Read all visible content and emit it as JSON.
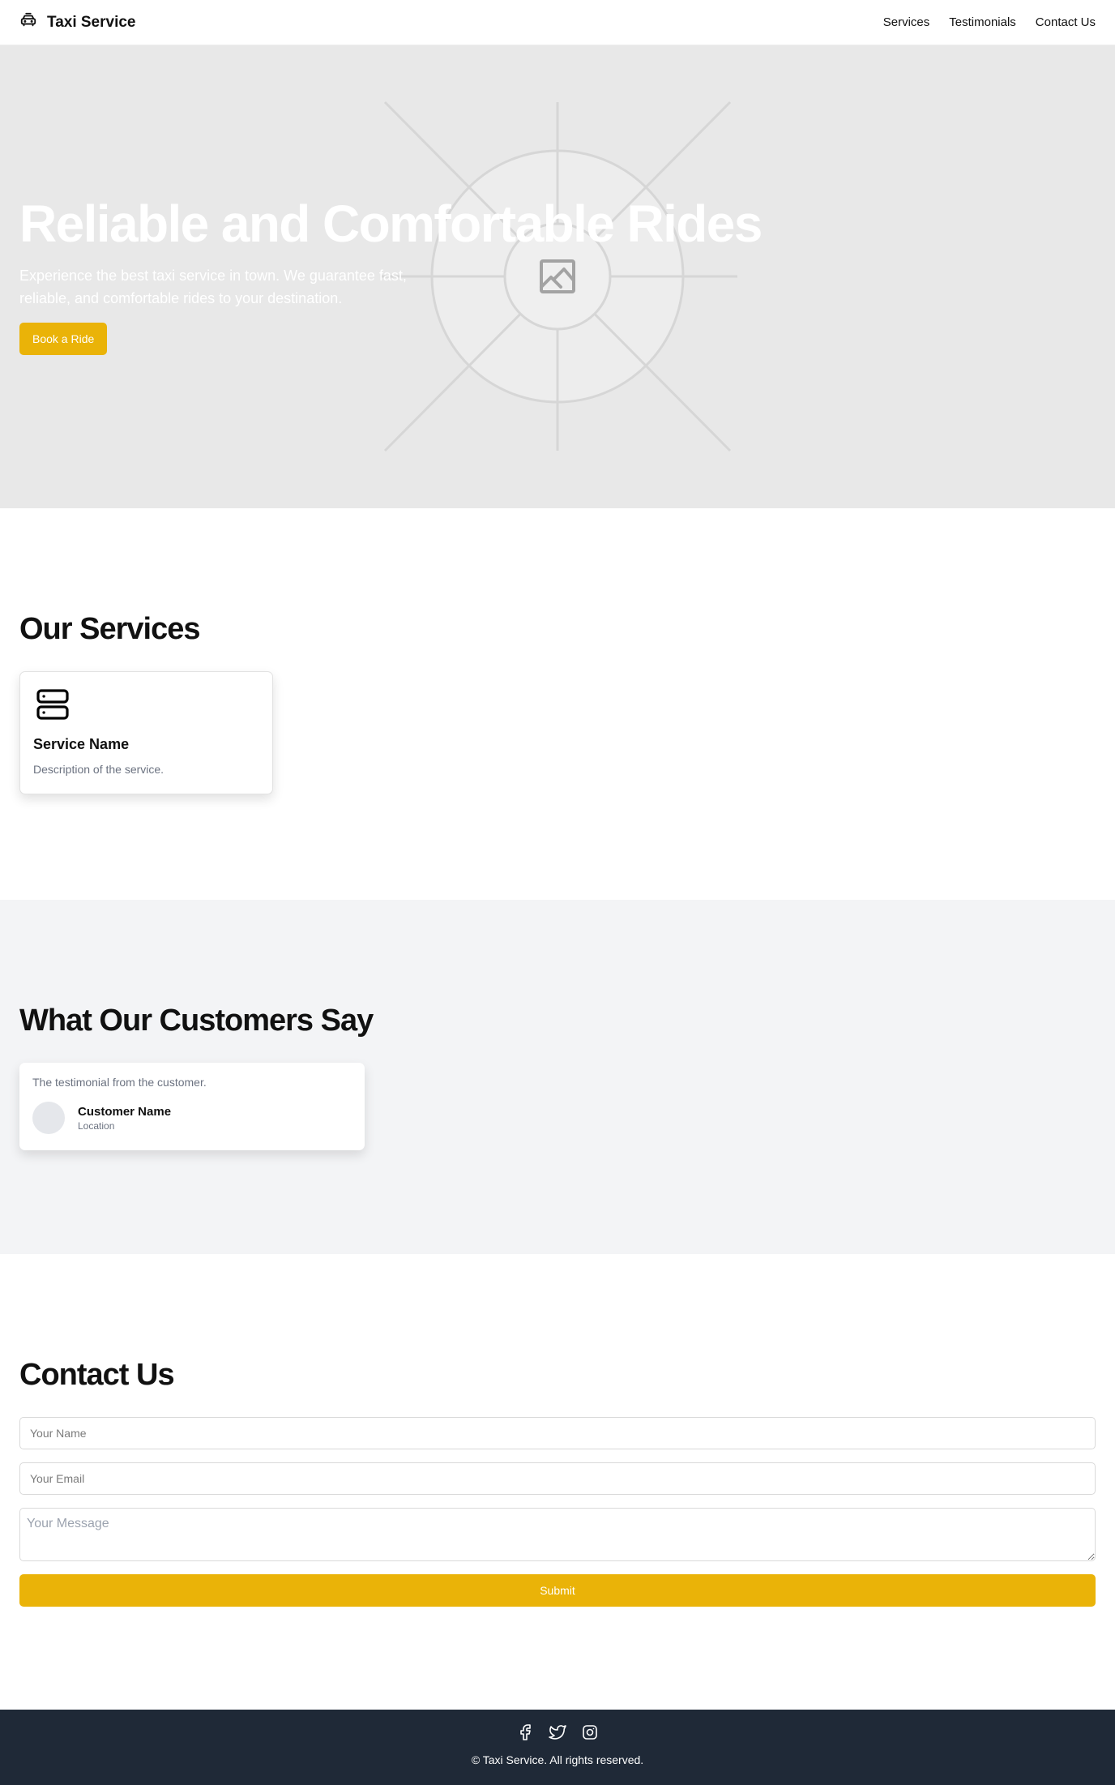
{
  "header": {
    "brand_icon": "taxi-icon",
    "brand_title": "Taxi Service",
    "nav": [
      {
        "label": "Services"
      },
      {
        "label": "Testimonials"
      },
      {
        "label": "Contact Us"
      }
    ]
  },
  "hero": {
    "title": "Reliable and Comfortable Rides",
    "subtitle": "Experience the best taxi service in town. We guarantee fast, reliable, and comfortable rides to your destination.",
    "cta_label": "Book a Ride",
    "background_icon": "image-placeholder-icon"
  },
  "services": {
    "title": "Our Services",
    "items": [
      {
        "icon": "server-icon",
        "name": "Service Name",
        "description": "Description of the service."
      }
    ]
  },
  "testimonials": {
    "title": "What Our Customers Say",
    "items": [
      {
        "text": "The testimonial from the customer.",
        "name": "Customer Name",
        "location": "Location"
      }
    ]
  },
  "contact": {
    "title": "Contact Us",
    "name_placeholder": "Your Name",
    "email_placeholder": "Your Email",
    "message_placeholder": "Your Message",
    "submit_label": "Submit"
  },
  "footer": {
    "socials": [
      "facebook-icon",
      "twitter-icon",
      "instagram-icon"
    ],
    "copyright": "© Taxi Service. All rights reserved."
  },
  "colors": {
    "accent": "#eab308",
    "footer_bg": "#1f2937",
    "hero_bg": "#e8e8e8",
    "section_alt_bg": "#f3f4f6"
  }
}
